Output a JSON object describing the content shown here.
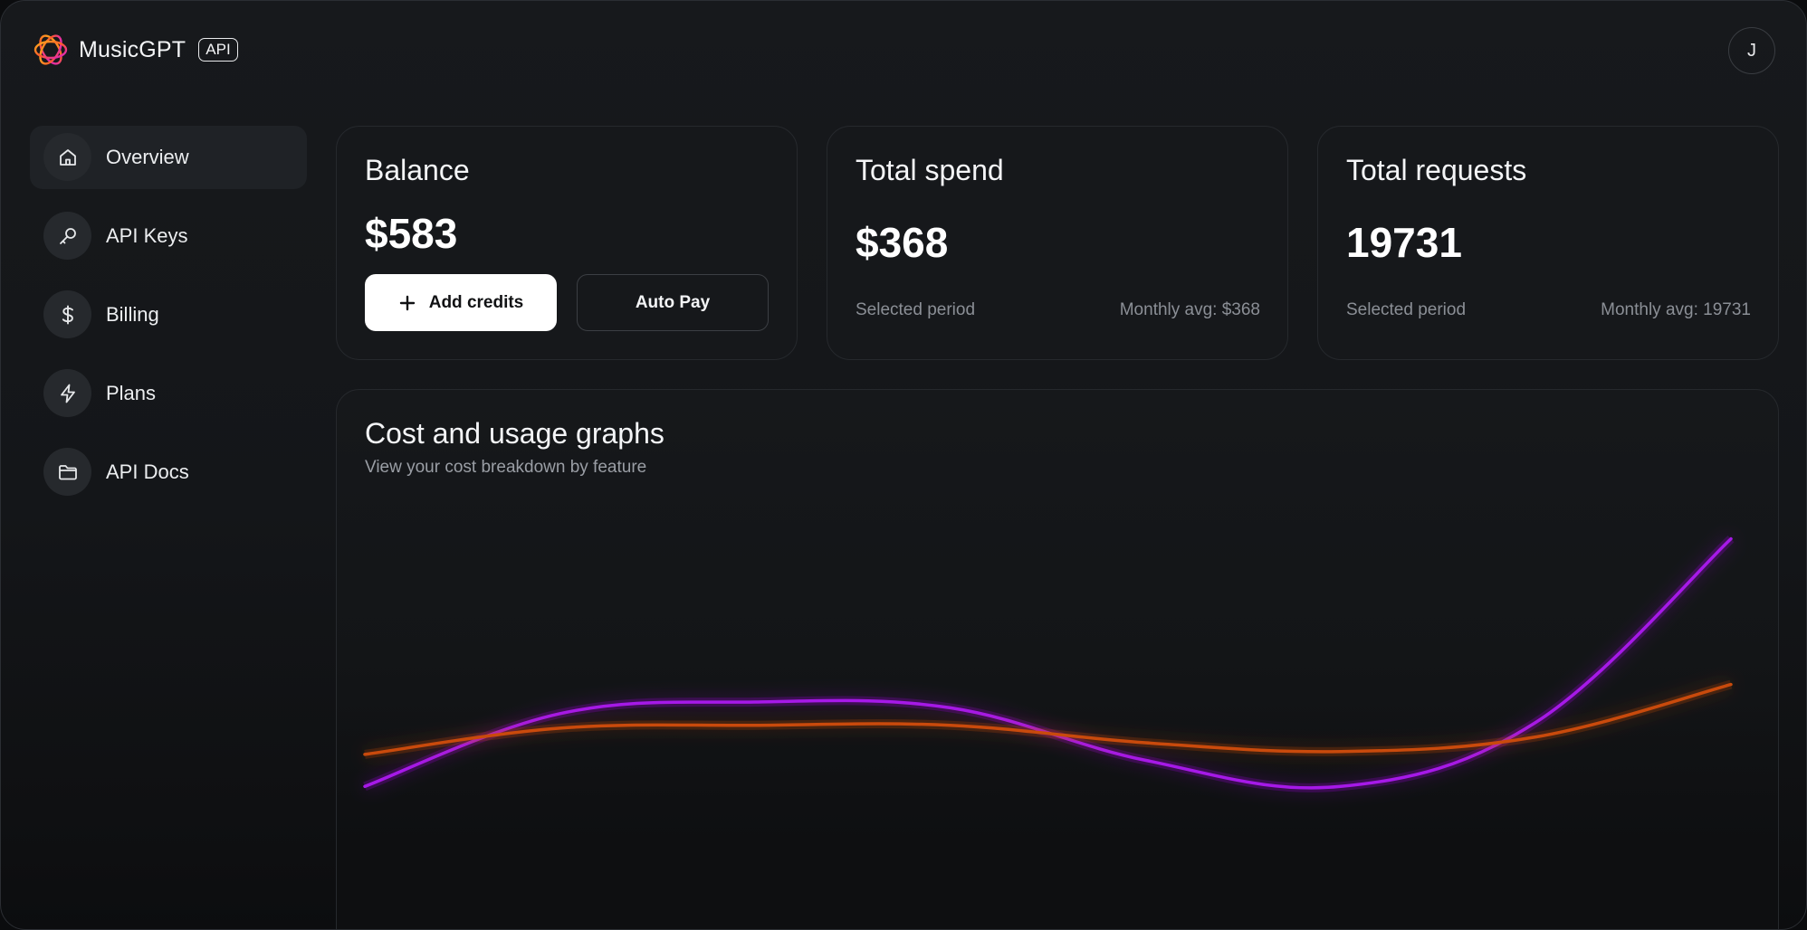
{
  "app": {
    "name": "MusicGPT",
    "badge": "API",
    "user_initial": "J"
  },
  "sidebar": {
    "items": [
      {
        "label": "Overview",
        "icon": "home-icon",
        "active": true
      },
      {
        "label": "API Keys",
        "icon": "key-icon",
        "active": false
      },
      {
        "label": "Billing",
        "icon": "dollar-icon",
        "active": false
      },
      {
        "label": "Plans",
        "icon": "lightning-icon",
        "active": false
      },
      {
        "label": "API Docs",
        "icon": "folder-icon",
        "active": false
      }
    ]
  },
  "cards": {
    "balance": {
      "title": "Balance",
      "value": "$583",
      "add_credits_label": "Add credits",
      "auto_pay_label": "Auto Pay"
    },
    "spend": {
      "title": "Total spend",
      "value": "$368",
      "period_label": "Selected period",
      "monthly_avg": "Monthly avg: $368"
    },
    "requests": {
      "title": "Total requests",
      "value": "19731",
      "period_label": "Selected period",
      "monthly_avg": "Monthly avg: 19731"
    }
  },
  "graph": {
    "title": "Cost and usage graphs",
    "subtitle": "View your cost breakdown by feature"
  },
  "colors": {
    "purple_series": "#a619e8",
    "orange_series": "#c94a0c",
    "accent_logo": "#ff7a1a"
  },
  "chart_data": {
    "type": "line",
    "title": "Cost and usage graphs",
    "subtitle": "View your cost breakdown by feature",
    "grid": false,
    "legend": "none",
    "x": [
      0,
      1,
      2,
      3,
      4,
      5,
      6,
      7
    ],
    "ylim": [
      0,
      100
    ],
    "series": [
      {
        "values": [
          3,
          28,
          32,
          30,
          12,
          3,
          25,
          88
        ],
        "color": "#a619e8"
      },
      {
        "values": [
          14,
          23,
          24,
          24,
          18,
          15,
          20,
          38
        ],
        "color": "#c94a0c"
      }
    ]
  }
}
